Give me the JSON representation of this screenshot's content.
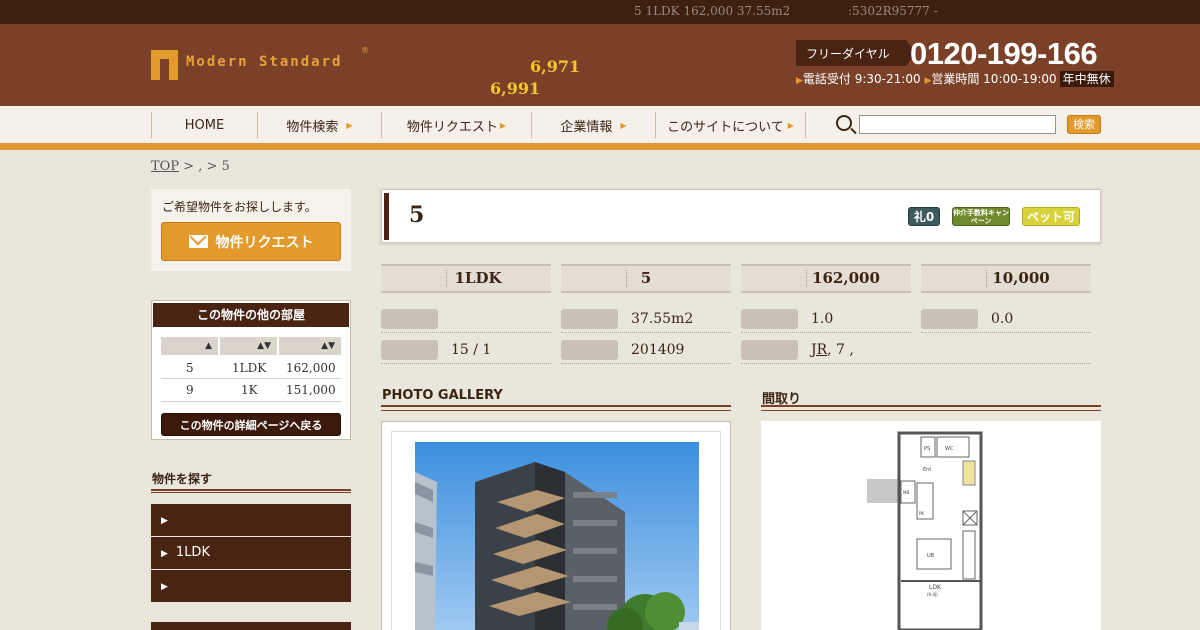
{
  "top_bar": {
    "summary": "5 1LDK 162,000 37.55m2",
    "code": ":5302R95777  -"
  },
  "header": {
    "logo_text": "Modern Standard",
    "logo_mark": "®",
    "count1": "6,971",
    "count2": "6,991",
    "tel_label": "フリーダイヤル",
    "tel_number": "0120-199-166",
    "hours_reception": "電話受付 9:30-21:00",
    "hours_business": "営業時間 10:00-19:00",
    "hours_badge": "年中無休"
  },
  "nav": {
    "items": [
      "HOME",
      "物件検索",
      "物件リクエスト",
      "企業情報",
      "このサイトについて"
    ],
    "search_button": "検索"
  },
  "breadcrumb": {
    "top": "TOP",
    "sep": " > , > 5"
  },
  "sidebar": {
    "request_text": "ご希望物件をお探しします。",
    "request_button": "物件リクエスト",
    "rooms_title": "この物件の他の部屋",
    "rooms": [
      {
        "floor": "5",
        "layout": "1LDK",
        "rent": "162,000"
      },
      {
        "floor": "9",
        "layout": "1K",
        "rent": "151,000"
      }
    ],
    "back_button": "この物件の詳細ページへ戻る",
    "find_title": "物件を探す",
    "find_items": [
      "",
      "1LDK",
      ""
    ]
  },
  "property": {
    "title": "5",
    "tags": [
      "礼0",
      "仲介手数料キャンペーン",
      "ペット可"
    ],
    "tag_colors": [
      "#3f5a5c",
      "#6f8a2e",
      "#d8d33a"
    ],
    "summary": [
      "1LDK",
      "5",
      "162,000",
      "10,000"
    ],
    "details": {
      "area": "37.55m2",
      "deposit": "1.0",
      "key_money": "0.0",
      "floor": "15 / 1",
      "built": "201409",
      "station_line": "JR",
      "station_rest": ", 7 ,"
    }
  },
  "sections": {
    "gallery": "PHOTO GALLERY",
    "floorplan": "間取り"
  },
  "floorplan_labels": {
    "ldk": "LDK",
    "ldk_size": "(9.4J)",
    "ent": "Ent",
    "wc": "WC",
    "ps": "PS",
    "mb": "MB",
    "ub": "UB",
    "pk": "PK"
  }
}
